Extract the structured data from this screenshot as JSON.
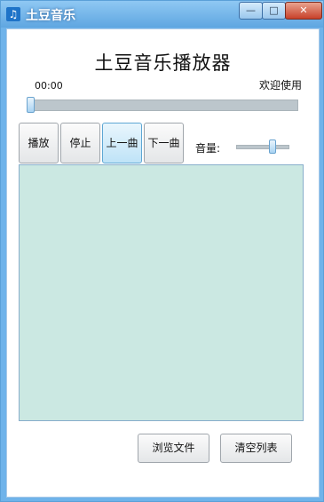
{
  "window": {
    "title": "土豆音乐",
    "app_icon": "music-note",
    "controls": {
      "minimize": "—",
      "maximize": "□",
      "close": "✕"
    }
  },
  "main": {
    "heading": "土豆音乐播放器",
    "time": "00:00",
    "welcome": "欢迎使用",
    "progress_fraction": 0,
    "buttons": {
      "play": "播放",
      "stop": "停止",
      "prev": "上一曲",
      "next": "下一曲"
    },
    "volume_label": "音量:",
    "volume_fraction": 0.72,
    "browse": "浏览文件",
    "clear": "清空列表"
  }
}
